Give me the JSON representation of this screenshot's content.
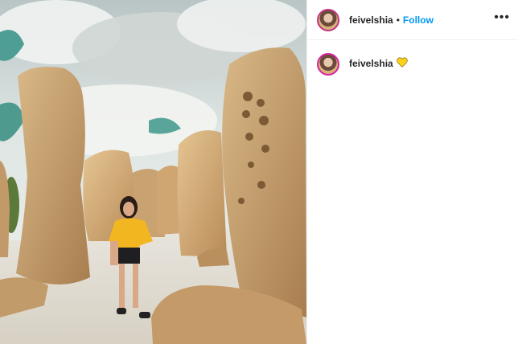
{
  "post": {
    "username": "feivelshia",
    "separator": "•",
    "follow_label": "Follow",
    "more_label": "•••",
    "caption_username": "feivelshia",
    "caption_emoji": "yellow-heart-icon",
    "colors": {
      "link": "#0095f6",
      "text": "#262626",
      "heart": "#ffd21e"
    }
  }
}
